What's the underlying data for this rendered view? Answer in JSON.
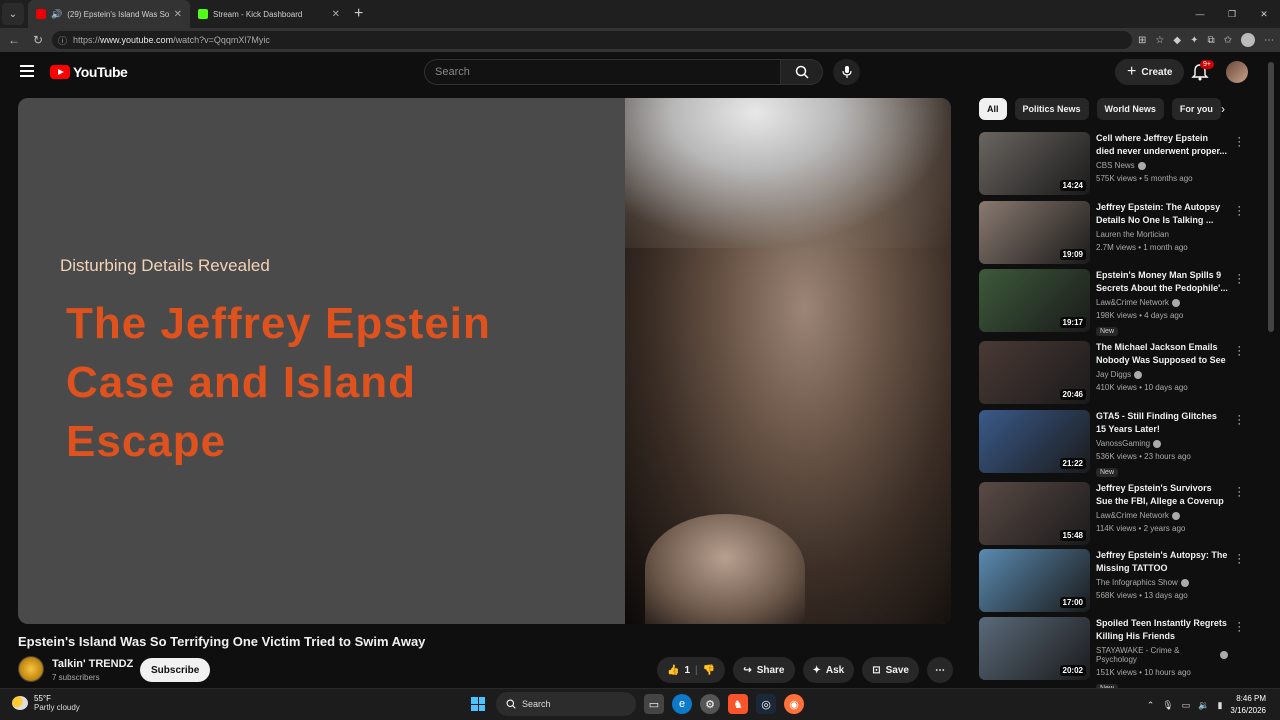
{
  "browser": {
    "tabs": [
      {
        "title": "(29) Epstein's Island Was So Te",
        "active": true
      },
      {
        "title": "Stream - Kick Dashboard",
        "active": false
      }
    ],
    "url_prefix": "https://",
    "url_host": "www.youtube.com",
    "url_path": "/watch?v=QqqmXl7Myic"
  },
  "header": {
    "logo_text": "YouTube",
    "search_placeholder": "Search",
    "create_label": "Create",
    "notification_count": "9+"
  },
  "video": {
    "overlay_subtitle": "Disturbing Details Revealed",
    "overlay_headline": "The Jeffrey Epstein Case and Island Escape",
    "title": "Epstein's Island Was So Terrifying One Victim Tried to Swim Away",
    "channel_name": "Talkin' TRENDZ",
    "subscribers": "7 subscribers",
    "subscribe_label": "Subscribe",
    "like_count": "1",
    "share_label": "Share",
    "ask_label": "Ask",
    "save_label": "Save"
  },
  "chips": [
    "All",
    "Politics News",
    "World News",
    "For you"
  ],
  "recommendations": [
    {
      "title": "Cell where Jeffrey Epstein died never underwent proper...",
      "channel": "CBS News",
      "verified": true,
      "meta": "575K views • 5 months ago",
      "duration": "14:24",
      "new": false,
      "thumb": "#6a6560"
    },
    {
      "title": "Jeffrey Epstein: The Autopsy Details No One Is Talking ...",
      "channel": "Lauren the Mortician",
      "verified": false,
      "meta": "2.7M views • 1 month ago",
      "duration": "19:09",
      "new": false,
      "thumb": "#8a7a70"
    },
    {
      "title": "Epstein's Money Man Spills 9 Secrets About the Pedophile'...",
      "channel": "Law&Crime Network",
      "verified": true,
      "meta": "198K views • 4 days ago",
      "duration": "19:17",
      "new": true,
      "thumb": "#3d5a3a"
    },
    {
      "title": "The Michael Jackson Emails Nobody Was Supposed to See",
      "channel": "Jay Diggs",
      "verified": true,
      "meta": "410K views • 10 days ago",
      "duration": "20:46",
      "new": false,
      "thumb": "#4a3a35"
    },
    {
      "title": "GTA5 - Still Finding Glitches 15 Years Later!",
      "channel": "VanossGaming",
      "verified": true,
      "meta": "536K views • 23 hours ago",
      "duration": "21:22",
      "new": true,
      "thumb": "#3a5a8a"
    },
    {
      "title": "Jeffrey Epstein's Survivors Sue the FBI, Allege a Coverup",
      "channel": "Law&Crime Network",
      "verified": true,
      "meta": "114K views • 2 years ago",
      "duration": "15:48",
      "new": false,
      "thumb": "#5a4a45"
    },
    {
      "title": "Jeffrey Epstein's Autopsy: The Missing TATTOO",
      "channel": "The Infographics Show",
      "verified": true,
      "meta": "568K views • 13 days ago",
      "duration": "17:00",
      "new": false,
      "thumb": "#5a8ab0"
    },
    {
      "title": "Spoiled Teen Instantly Regrets Killing His Friends",
      "channel": "STAYAWAKE - Crime & Psychology",
      "verified": true,
      "meta": "151K views • 10 hours ago",
      "duration": "20:02",
      "new": true,
      "thumb": "#5a6a7a"
    }
  ],
  "taskbar": {
    "temperature": "55°F",
    "condition": "Partly cloudy",
    "search_label": "Search",
    "time": "8:46 PM",
    "date": "3/16/2026"
  },
  "colors": {
    "accent_red": "#ff0000",
    "headline_orange": "#e0521d",
    "subtitle_peach": "#f3d3b8"
  }
}
